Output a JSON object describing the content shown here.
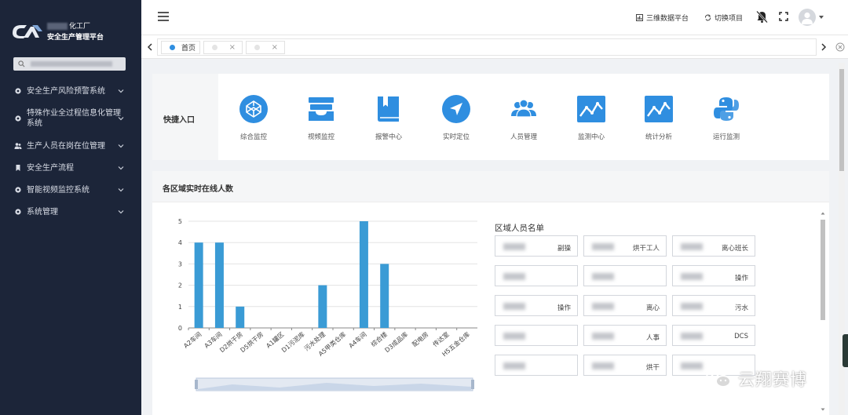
{
  "sidebar": {
    "logo_line1": "化工厂",
    "logo_line2": "安全生产管理平台",
    "menu": [
      {
        "label": "安全生产风险预警系统",
        "icon": "gear-icon"
      },
      {
        "label": "特殊作业全过程信息化管理系统",
        "icon": "gear-icon"
      },
      {
        "label": "生产人员在岗在位管理",
        "icon": "people-icon"
      },
      {
        "label": "安全生产流程",
        "icon": "bookmark-icon"
      },
      {
        "label": "智能视频监控系统",
        "icon": "gear-icon"
      },
      {
        "label": "系统管理",
        "icon": "gear-icon"
      }
    ]
  },
  "header": {
    "link_3d": "三维数据平台",
    "link_switch": "切换项目"
  },
  "tabs": [
    {
      "label": "首页",
      "active": true
    },
    {
      "label": "",
      "active": false
    },
    {
      "label": "",
      "active": false
    }
  ],
  "tab_close_symbol": "×",
  "quick": {
    "title": "快捷入口",
    "items": [
      {
        "label": "综合监控",
        "icon": "codepen-icon"
      },
      {
        "label": "视频监控",
        "icon": "inbox-icon"
      },
      {
        "label": "报警中心",
        "icon": "book-icon"
      },
      {
        "label": "实时定位",
        "icon": "navigation-icon"
      },
      {
        "label": "人员管理",
        "icon": "users-icon"
      },
      {
        "label": "监测中心",
        "icon": "line-chart-icon"
      },
      {
        "label": "统计分析",
        "icon": "line-chart-icon"
      },
      {
        "label": "运行监测",
        "icon": "python-icon"
      }
    ]
  },
  "panel": {
    "title": "各区域实时在线人数"
  },
  "chart_data": {
    "type": "bar",
    "categories": [
      "A2车间",
      "A3车间",
      "D2烘干房",
      "D5烘干房",
      "A1罐区",
      "D1污泥库",
      "污水处理",
      "A5甲类仓库",
      "A4车间",
      "综合楼",
      "D3成品库",
      "配电房",
      "传达室",
      "H5五金仓库"
    ],
    "values": [
      4,
      4,
      1,
      0,
      0,
      0,
      2,
      0,
      5,
      3,
      0,
      0,
      0,
      0
    ],
    "ylim": [
      0,
      5
    ],
    "yticks": [
      0,
      1,
      2,
      3,
      4,
      5
    ],
    "grid": true,
    "color": "#3a9bd5"
  },
  "roster": {
    "title": "区域人员名单",
    "cells": [
      "副操",
      "烘干工人",
      "离心班长",
      "",
      "",
      "操作",
      "操作",
      "离心",
      "污水",
      "",
      "人事",
      "DCS",
      "",
      "烘干",
      ""
    ]
  },
  "watermark": "云翔赛博",
  "colors": {
    "sidebar_bg": "#1c2539",
    "accent": "#2f8ee0",
    "tab_active_dot": "#2f8ee0"
  }
}
